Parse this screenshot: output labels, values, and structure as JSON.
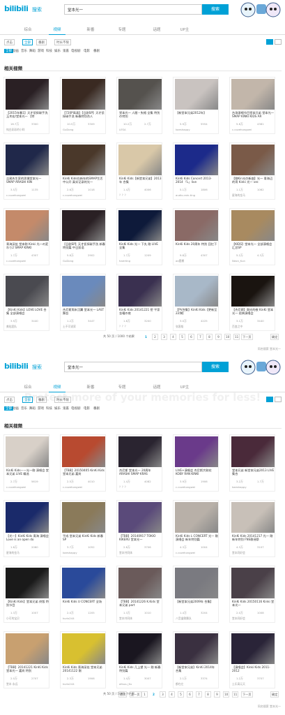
{
  "screens": [
    {
      "logo_text": "bilibili",
      "logo_sub": "搜索",
      "search_value": "堂本光一",
      "search_button": "搜索",
      "tabs": [
        "综合",
        "视频",
        "新番",
        "专题",
        "话题",
        "UP主"
      ],
      "active_tab": 1,
      "filters": {
        "sort": "点击",
        "range": "全部",
        "type": "番剧",
        "duration": "时长不限"
      },
      "categories": [
        "全部",
        "动画",
        "音乐",
        "舞蹈",
        "游戏",
        "科技",
        "娱乐",
        "鬼畜",
        "电视剧",
        "电影",
        "番剧"
      ],
      "section_title": "相关视频",
      "cards": [
        {
          "title": "【2015年春1】天才侦探碳手洗 玉木宏/堂本光一 【特",
          "plays": "16.7万",
          "danmaku": "3300",
          "uploader": "纯白彩彩的小咩",
          "thumb": "#2a2024"
        },
        {
          "title": "【720P高清】【日剧SP】天才侦探碳手洗 新春特别合人",
          "plays": "10.5万",
          "danmaku": "3309",
          "uploader": "GuDong",
          "thumb": "#3a2a22"
        },
        {
          "title": "堂本光一 人間・失格 全集 特別の特別",
          "plays": "10.2万",
          "danmaku": "2.7万",
          "uploader": "LESA",
          "thumb": "#55524e"
        },
        {
          "title": "【新堂本兄弟2012年】",
          "plays": "5.9万",
          "danmaku": "5554",
          "uploader": "kaeshappy",
          "thumb": "#c9c3c0"
        },
        {
          "title": "台场演唱节目堂本兄弟 堂本光一 SMAP KINKI KIDS AR",
          "plays": "5.6万",
          "danmaku": "4381",
          "uploader": "c.cozehongwei",
          "thumb": "#c2b6aa"
        },
        {
          "title": "吉尾先生家的男僕堂本光一 SMAP ARASHI KIN",
          "plays": "3.5万",
          "danmaku": "1135",
          "uploader": "c.cozehongwei",
          "thumb": "#20284a"
        },
        {
          "title": "KinKi Kids在新年的SMAP生活中公开 真实记录的光一",
          "plays": "2.6万",
          "danmaku": "1018",
          "uploader": "c.cozehongwei",
          "thumb": "#4a382a"
        },
        {
          "title": "KinKi Kids【新堂本兄弟】2013年 合集",
          "plays": "1.4万",
          "danmaku": "4006",
          "uploader": "？？？",
          "thumb": "#d9c8a8"
        },
        {
          "title": "KinKi Kids Concert 2013-2014 「L」live",
          "plays": "5.1万",
          "danmaku": "1806",
          "uploader": "audio-rain-ting",
          "thumb": "#1c2a8a"
        },
        {
          "title": "【剛Kin光の新曲】光一 青海辺的宵 Kinki 光一 ver.",
          "plays": "1.1万",
          "danmaku": "1062",
          "uploader": "星海的金马",
          "thumb": "#7a5a48"
        },
        {
          "title": "青海深处 堂本剛 Kinki 光一の変わり2 SMAP KINKI",
          "plays": "1.7万",
          "danmaku": "4307",
          "uploader": "c.cozehongwei",
          "thumb": "#c48a6a"
        },
        {
          "title": "【日剧SP】天才侦探碳手洗 新春特别篇 中日双语",
          "plays": "5.8万",
          "danmaku": "2902",
          "uploader": "GuDong",
          "thumb": "#2a2024"
        },
        {
          "title": "KinKi Kids 光一 下丸 剛 LIVE 全集",
          "plays": "1.7万",
          "danmaku": "1209",
          "uploader": "haerting",
          "thumb": "#0e1a3a"
        },
        {
          "title": "KinKi Kids 20周年 特別 回忆下",
          "plays": "9.8万",
          "danmaku": "4307",
          "uploader": "ae鹿酱",
          "thumb": "#8a6a66"
        },
        {
          "title": "【KIDS】堂本光一 全部演唱会汇总SP",
          "plays": "5.2万",
          "danmaku": "4.3万",
          "uploader": "Neon_Kun",
          "thumb": "#a88a60"
        },
        {
          "title": "【KinKi Kids】LOVE LOVE 合集 全部演唱会",
          "plays": "3.9万",
          "danmaku": "3440",
          "uploader": "美哒团队",
          "thumb": "#4a4a50"
        },
        {
          "title": "杰尼斯周末沉翼 堂本光一 LAST舞台",
          "plays": "1.2万",
          "danmaku": "3447",
          "uploader": "土不可说家",
          "thumb": "#6a8abc"
        },
        {
          "title": "KinKi Kids 20141221 密 平家 金曜の夜",
          "plays": "1.8万",
          "danmaku": "3200",
          "uploader": "？？？",
          "thumb": "#3a3050"
        },
        {
          "title": "【PV合集】KinKi Kids【更新至22弹】",
          "plays": "3.0万",
          "danmaku": "4225",
          "uploader": "张客船",
          "thumb": "#a8b8c8"
        },
        {
          "title": "【杰尼斯】剛光的夜 KinKi 堂本光一 经典演唱会",
          "plays": "3.1万",
          "danmaku": "3440",
          "uploader": "百变之中",
          "thumb": "#1a1410"
        }
      ],
      "pager": {
        "info": "共 50 页 / 1000 个结果",
        "first": "首页",
        "prev": "上一页",
        "pages": [
          "1",
          "2",
          "3",
          "4",
          "5",
          "6",
          "7",
          "8",
          "9",
          "10",
          "11"
        ],
        "current": "1",
        "next": "下一页",
        "jump": "确定"
      },
      "footer": "同名搜索 堂本光一"
    },
    {
      "logo_text": "bilibili",
      "logo_sub": "搜索",
      "search_value": "堂本光一",
      "search_button": "搜索",
      "tabs": [
        "综合",
        "视频",
        "新番",
        "专题",
        "话题",
        "UP主"
      ],
      "active_tab": 1,
      "filters": {
        "sort": "点击",
        "range": "全部",
        "type": "番剧",
        "duration": "时长不限"
      },
      "categories": [
        "全部",
        "动画",
        "音乐",
        "舞蹈",
        "游戏",
        "科技",
        "娱乐",
        "鬼畜",
        "电视剧",
        "电影",
        "番剧"
      ],
      "section_title": "相关视频",
      "cards": [
        {
          "title": "KinKi Kids——光一剛 演唱会 堂本兄弟 LIVE 精选",
          "plays": "2.7万",
          "danmaku": "5619",
          "uploader": "c.cozehongwei",
          "thumb": "#d8d0c8"
        },
        {
          "title": "【TBB】20150405 KinKi Kids 堂本兄弟 嘉宾",
          "plays": "2.5万",
          "danmaku": "4010",
          "uploader": "c.cozehongwei",
          "thumb": "#b84a30"
        },
        {
          "title": "杰尼斯 堂本光一 20周年 ARASHI SMAP KRAS",
          "plays": "1.4万",
          "danmaku": "4082",
          "uploader": "？？？",
          "thumb": "#2a2430"
        },
        {
          "title": "LIVE+演唱会 杰尼斯大联欢 KOBY RAN KINKI",
          "plays": "3.9万",
          "danmaku": "1906",
          "uploader": "c.cozehongwei",
          "thumb": "#6a3a8a"
        },
        {
          "title": "堂本兄弟 新堂本兄弟2013 LIVE 集合",
          "plays": "3.2万",
          "danmaku": "1.7万",
          "uploader": "kaeshappy",
          "thumb": "#4a2a3a"
        },
        {
          "title": "【光一】KinKi Kids 青海 演唱会 Love is an open do",
          "plays": "1.8万",
          "danmaku": "2060",
          "uploader": "星海的金马",
          "thumb": "#1a2a6a"
        },
        {
          "title": "平成 堂本兄弟 KinKi Kids 新春SP",
          "plays": "3.7万",
          "danmaku": "1052",
          "uploader": "kaeshappy",
          "thumb": "#8a7a5a"
        },
        {
          "title": "【TBB】20140917 TOKIO KIKERU 堂本光一",
          "plays": "2.8万",
          "danmaku": "3706",
          "uploader": "堂本共同体",
          "thumb": "#5a4a7a"
        },
        {
          "title": "KinKi Kids L CONCERT 光一 剛 演唱会 新年特别篇",
          "plays": "4.3万",
          "danmaku": "1004",
          "uploader": "c.cozehongwei",
          "thumb": "#b8b0a8"
        },
        {
          "title": "KinKi Kids 20141217 光一 剛 新年特别 FNS歌谣祭",
          "plays": "4.3万",
          "danmaku": "3107",
          "uploader": "堂本同好会",
          "thumb": "#c8c0b8"
        },
        {
          "title": "【KinKi Kids】堂本兄弟 终版 特别节目",
          "plays": "1.3万",
          "danmaku": "1007",
          "uploader": "小可的宝贝",
          "thumb": "#1a1a1a"
        },
        {
          "title": "KinKi Kids U CONCERT 全场",
          "plays": "2.0万",
          "danmaku": "1205",
          "uploader": "kurio244",
          "thumb": "#2a4a9a"
        },
        {
          "title": "【TBB】20141226 K.Kids 堂本兄弟 part",
          "plays": "1.3万",
          "danmaku": "1010",
          "uploader": "堂本共同体",
          "thumb": "#6a5a5a"
        },
        {
          "title": "【新堂本兄弟2009年 合集】",
          "plays": "1.4万",
          "danmaku": "3204",
          "uploader": "八音盒歌舞队",
          "thumb": "#7a7a80"
        },
        {
          "title": "KinKi Kids 20150116 Kinki 堂本光一",
          "plays": "2.0万",
          "danmaku": "1008",
          "uploader": "堂本同好会",
          "thumb": "#4a4048"
        },
        {
          "title": "【TBB】20141221 KinKi Kids 堂本光一 嘉宾 特别",
          "plays": "2.0万",
          "danmaku": "2707",
          "uploader": "堂本 永远",
          "thumb": "#c8a070"
        },
        {
          "title": "KinKi Kids 青海深处 堂本兄弟 20141122 剛",
          "plays": "2.3万",
          "danmaku": "1906",
          "uploader": "kurio244",
          "thumb": "#d8c030"
        },
        {
          "title": "KinKi Kids 几上望 光一 剛 新春特别篇",
          "plays": "1.4万",
          "danmaku": "3007",
          "uploader": "aitsuu_Ku",
          "thumb": "#1a1620"
        },
        {
          "title": "【新堂本兄弟】KinKi 2014年 合集",
          "plays": "2.1万",
          "danmaku": "3374",
          "uploader": "都在左",
          "thumb": "#3a3040"
        },
        {
          "title": "【演唱会】Kinki Kids 2011-2012",
          "plays": "1.2万",
          "danmaku": "3707",
          "uploader": "土乐高元天",
          "thumb": "#2a2438"
        }
      ],
      "pager": {
        "info": "共 50 页 / 1000 个结果",
        "first": "首页",
        "prev": "上一页",
        "pages": [
          "1",
          "2",
          "3",
          "4",
          "5",
          "6",
          "7",
          "8",
          "9",
          "10",
          "11"
        ],
        "current": "2",
        "next": "下一页",
        "jump": "确定"
      },
      "footer": "同名搜索 堂本光一"
    }
  ],
  "watermark": "Protect more of your memories for less!"
}
